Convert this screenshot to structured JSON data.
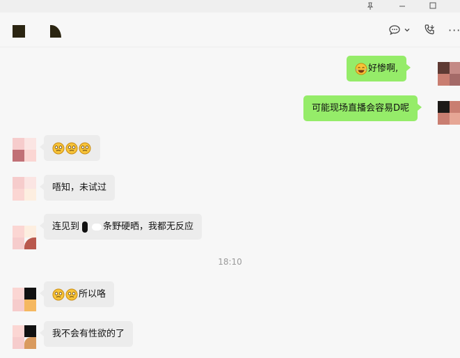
{
  "titlebar": {
    "pin_icon": "pin-icon",
    "maximize_icon": "maximize-icon",
    "close_icon": "close-icon"
  },
  "header": {
    "chat_icon": "chat-bubble-icon",
    "chevron": "⌄",
    "call_icon": "phone-call-icon",
    "more": "···"
  },
  "messages": [
    {
      "side": "right",
      "text": "好惨啊,",
      "emoji_count": 1,
      "emoji": "laughing-tears-emoji"
    },
    {
      "side": "right",
      "text": "可能现场直播会容易D呢"
    },
    {
      "side": "left",
      "text": "",
      "emoji_count": 3,
      "emoji": "confused-face-emoji"
    },
    {
      "side": "left",
      "text": "唔知，未试过"
    },
    {
      "side": "left",
      "text_before": "连见到",
      "text_after": "条野硬晒，我都无反应"
    },
    {
      "side": "left",
      "text": "所以咯",
      "emoji_count": 2,
      "emoji": "confused-face-emoji"
    },
    {
      "side": "left",
      "text": "我不会有性欲的了"
    }
  ],
  "timestamp": "18:10",
  "colors": {
    "sent_bubble": "#95ec69",
    "received_bubble": "#ececec",
    "background": "#f7f7f7"
  }
}
